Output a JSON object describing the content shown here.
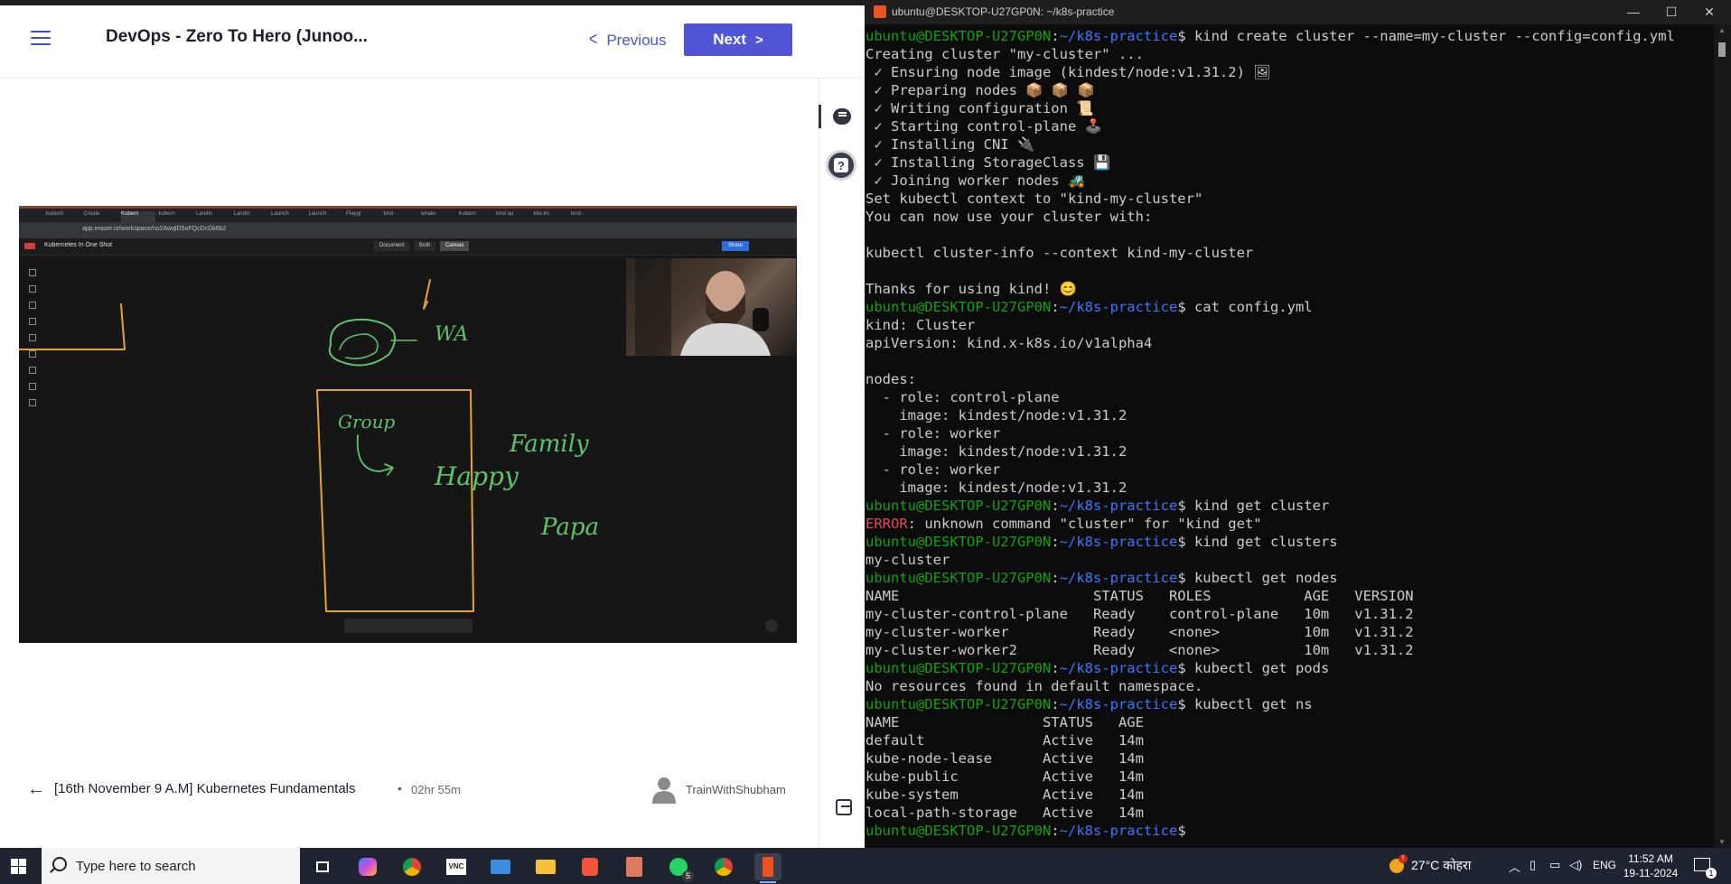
{
  "course": {
    "title": "DevOps - Zero To Hero (Junoo...",
    "previous_label": "Previous",
    "next_label": "Next"
  },
  "video": {
    "tabs": [
      "kubectl",
      "Create",
      "Kubern",
      "kubern",
      "LandIn",
      "LandIn",
      "Launch",
      "Launch",
      "Playgr",
      "kind -",
      "whale-",
      "Kubern",
      "kind qu",
      "k8s-lin",
      "kind -"
    ],
    "url": "app.eraser.io/workspace/no2AwqlD5oFQcDcDk6b2",
    "doc_title": "Kubernetes In One Shot",
    "segments": [
      "Document",
      "Both",
      "Canvas"
    ],
    "share_label": "Share",
    "whiteboard_words": [
      "WA",
      "Group",
      "Happy",
      "Family",
      "Papa"
    ]
  },
  "lesson": {
    "title": "[16th November 9 A.M] Kubernetes Fundamentals",
    "separator": "•",
    "duration": "02hr 55m",
    "author": "TrainWithShubham"
  },
  "terminal": {
    "window_title": "ubuntu@DESKTOP-U27GP0N: ~/k8s-practice",
    "prompt_user": "ubuntu@DESKTOP-U27GP0N",
    "prompt_path": "~/k8s-practice",
    "lines": [
      {
        "cmd": "kind create cluster --name=my-cluster --config=config.yml"
      },
      {
        "out": "Creating cluster \"my-cluster\" ..."
      },
      {
        "out": " ✓ Ensuring node image (kindest/node:v1.31.2) 🖼"
      },
      {
        "out": " ✓ Preparing nodes 📦 📦 📦"
      },
      {
        "out": " ✓ Writing configuration 📜"
      },
      {
        "out": " ✓ Starting control-plane 🕹️"
      },
      {
        "out": " ✓ Installing CNI 🔌"
      },
      {
        "out": " ✓ Installing StorageClass 💾"
      },
      {
        "out": " ✓ Joining worker nodes 🚜"
      },
      {
        "out": "Set kubectl context to \"kind-my-cluster\""
      },
      {
        "out": "You can now use your cluster with:"
      },
      {
        "out": ""
      },
      {
        "out": "kubectl cluster-info --context kind-my-cluster"
      },
      {
        "out": ""
      },
      {
        "out": "Thanks for using kind! 😊"
      },
      {
        "cmd": "cat config.yml"
      },
      {
        "out": "kind: Cluster"
      },
      {
        "out": "apiVersion: kind.x-k8s.io/v1alpha4"
      },
      {
        "out": ""
      },
      {
        "out": "nodes:"
      },
      {
        "out": "  - role: control-plane"
      },
      {
        "out": "    image: kindest/node:v1.31.2"
      },
      {
        "out": "  - role: worker"
      },
      {
        "out": "    image: kindest/node:v1.31.2"
      },
      {
        "out": "  - role: worker"
      },
      {
        "out": "    image: kindest/node:v1.31.2"
      },
      {
        "cmd": "kind get cluster"
      },
      {
        "err": "ERROR",
        "out": ": unknown command \"cluster\" for \"kind get\""
      },
      {
        "cmd": "kind get clusters"
      },
      {
        "out": "my-cluster"
      },
      {
        "cmd": "kubectl get nodes"
      },
      {
        "out": "NAME                       STATUS   ROLES           AGE   VERSION"
      },
      {
        "out": "my-cluster-control-plane   Ready    control-plane   10m   v1.31.2"
      },
      {
        "out": "my-cluster-worker          Ready    <none>          10m   v1.31.2"
      },
      {
        "out": "my-cluster-worker2         Ready    <none>          10m   v1.31.2"
      },
      {
        "cmd": "kubectl get pods"
      },
      {
        "out": "No resources found in default namespace."
      },
      {
        "cmd": "kubectl get ns"
      },
      {
        "out": "NAME                 STATUS   AGE"
      },
      {
        "out": "default              Active   14m"
      },
      {
        "out": "kube-node-lease      Active   14m"
      },
      {
        "out": "kube-public          Active   14m"
      },
      {
        "out": "kube-system          Active   14m"
      },
      {
        "out": "local-path-storage   Active   14m"
      },
      {
        "cmd": ""
      }
    ]
  },
  "taskbar": {
    "search_placeholder": "Type here to search",
    "weather": "27°C कोहरा",
    "language": "ENG",
    "time": "11:52 AM",
    "date": "19-11-2024",
    "whatsapp_badge": "5",
    "notification_count": "1"
  },
  "colors": {
    "accent": "#4f55d4",
    "prompt_user": "#13a10e",
    "prompt_path": "#3b78ff",
    "error": "#e74856"
  }
}
